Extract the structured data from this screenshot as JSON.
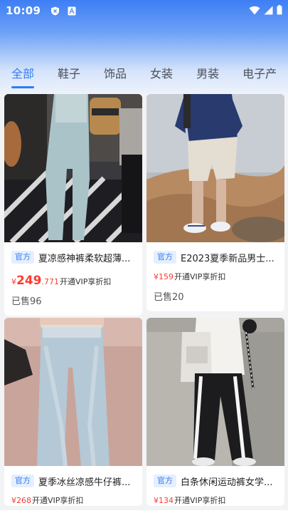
{
  "status_bar": {
    "time": "10:09",
    "icons": [
      "shield-x-icon",
      "font-a-icon",
      "wifi-icon",
      "cellular-icon",
      "battery-icon"
    ]
  },
  "tabs": [
    {
      "label": "全部",
      "active": true
    },
    {
      "label": "鞋子",
      "active": false
    },
    {
      "label": "饰品",
      "active": false
    },
    {
      "label": "女装",
      "active": false
    },
    {
      "label": "男装",
      "active": false
    },
    {
      "label": "电子产",
      "active": false
    }
  ],
  "products": [
    {
      "tag": "官方",
      "title": "夏凉感神裤柔软超薄...",
      "yen": "¥",
      "price_int": "249",
      "price_dec": ".771",
      "vip": "开通VIP享折扣",
      "sold": "已售96"
    },
    {
      "tag": "官方",
      "title": "E2023夏季新品男士...",
      "yen": "¥",
      "price_int": "159",
      "price_dec": "",
      "vip": "开通VIP享折扣",
      "sold": "已售20"
    },
    {
      "tag": "官方",
      "title": "夏季冰丝凉感牛仔裤...",
      "yen": "¥",
      "price_int": "268",
      "price_dec": "",
      "vip": "开通VIP享折扣",
      "sold": ""
    },
    {
      "tag": "官方",
      "title": "白条休闲运动裤女学...",
      "yen": "¥",
      "price_int": "134",
      "price_dec": "",
      "vip": "开通VIP享折扣",
      "sold": ""
    }
  ],
  "colors": {
    "accent": "#2f7cf6",
    "price": "#ff3b30"
  }
}
